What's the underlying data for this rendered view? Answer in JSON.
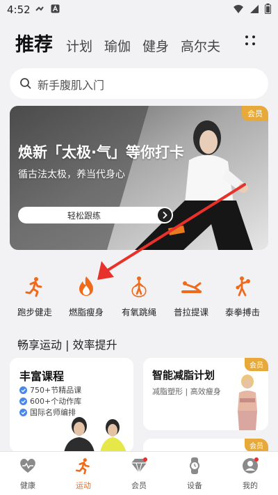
{
  "status_bar": {
    "time": "4:52"
  },
  "top_tabs": [
    "推荐",
    "计划",
    "瑜伽",
    "健身",
    "高尔夫"
  ],
  "search": {
    "placeholder": "新手腹肌入门"
  },
  "banner": {
    "badge": "会员",
    "title": "焕新「太极·气」等你打卡",
    "subtitle": "循古法太极，养当代身心",
    "button": "轻松跟练"
  },
  "categories": [
    {
      "label": "跑步健走",
      "icon": "runner-icon"
    },
    {
      "label": "燃脂瘦身",
      "icon": "flame-icon"
    },
    {
      "label": "有氧跳绳",
      "icon": "jump-rope-icon"
    },
    {
      "label": "普拉提课",
      "icon": "pilates-icon"
    },
    {
      "label": "泰拳搏击",
      "icon": "boxing-icon"
    }
  ],
  "section_title": "畅享运动 | 效率提升",
  "card_left": {
    "title": "丰富课程",
    "features": [
      "750+节精品课",
      "600+个动作库",
      "国际名师编排"
    ]
  },
  "card_right": {
    "badge": "会员",
    "title": "智能减脂计划",
    "subtitle": "减脂塑形 | 高效瘦身"
  },
  "card_right2": {
    "badge": "会员"
  },
  "bottom_nav": [
    {
      "label": "健康",
      "icon": "heart-icon",
      "active": false
    },
    {
      "label": "运动",
      "icon": "runner-icon",
      "active": true
    },
    {
      "label": "会员",
      "icon": "diamond-icon",
      "active": false
    },
    {
      "label": "设备",
      "icon": "watch-icon",
      "active": false
    },
    {
      "label": "我的",
      "icon": "user-icon",
      "active": false
    }
  ],
  "colors": {
    "accent": "#f06a1c",
    "vip": "#e7a93a",
    "arrow": "#e8312a"
  }
}
